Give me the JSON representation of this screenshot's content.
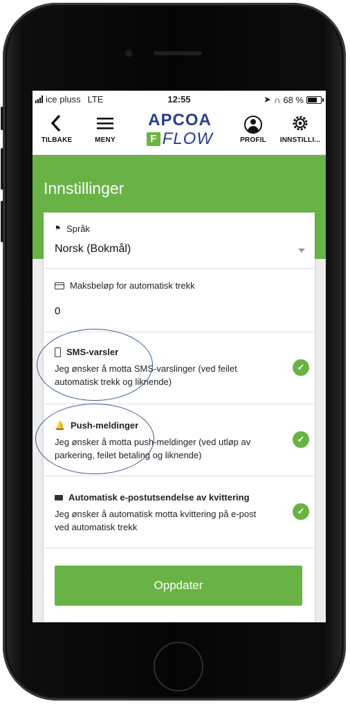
{
  "status_bar": {
    "carrier": "ice pluss",
    "network": "LTE",
    "time": "12:55",
    "battery": "68 %"
  },
  "nav": {
    "back_label": "TILBAKE",
    "menu_label": "MENY",
    "profile_label": "PROFIL",
    "settings_label": "INNSTILLI...",
    "logo_top": "APCOA",
    "logo_mark": "F",
    "logo_bottom": "FLOW"
  },
  "page": {
    "title": "Innstillinger"
  },
  "settings": {
    "language": {
      "label": "Språk",
      "value": "Norsk (Bokmål)"
    },
    "max_amount": {
      "label": "Maksbeløp for automatisk trekk",
      "value": "0"
    },
    "sms": {
      "label": "SMS-varsler",
      "description": "Jeg ønsker å motta SMS-varslinger (ved feilet automatisk trekk og liknende)",
      "enabled": true
    },
    "push": {
      "label": "Push-meldinger",
      "description": "Jeg ønsker å motta push-meldinger (ved utløp av parkering, feilet betaling og liknende)",
      "enabled": true
    },
    "email_receipt": {
      "label": "Automatisk e-postutsendelse av kvittering",
      "description": "Jeg ønsker å automatisk motta kvittering på e-post ved automatisk trekk",
      "enabled": true
    }
  },
  "update_button": "Oppdater",
  "colors": {
    "brand_green": "#69b346",
    "brand_navy": "#2a3d8f",
    "annotation_blue": "#3b5b93"
  },
  "icons": {
    "back": "chevron-left-icon",
    "menu": "hamburger-icon",
    "profile": "user-circle-icon",
    "settings": "gear-icon",
    "check": "check-circle-icon"
  }
}
